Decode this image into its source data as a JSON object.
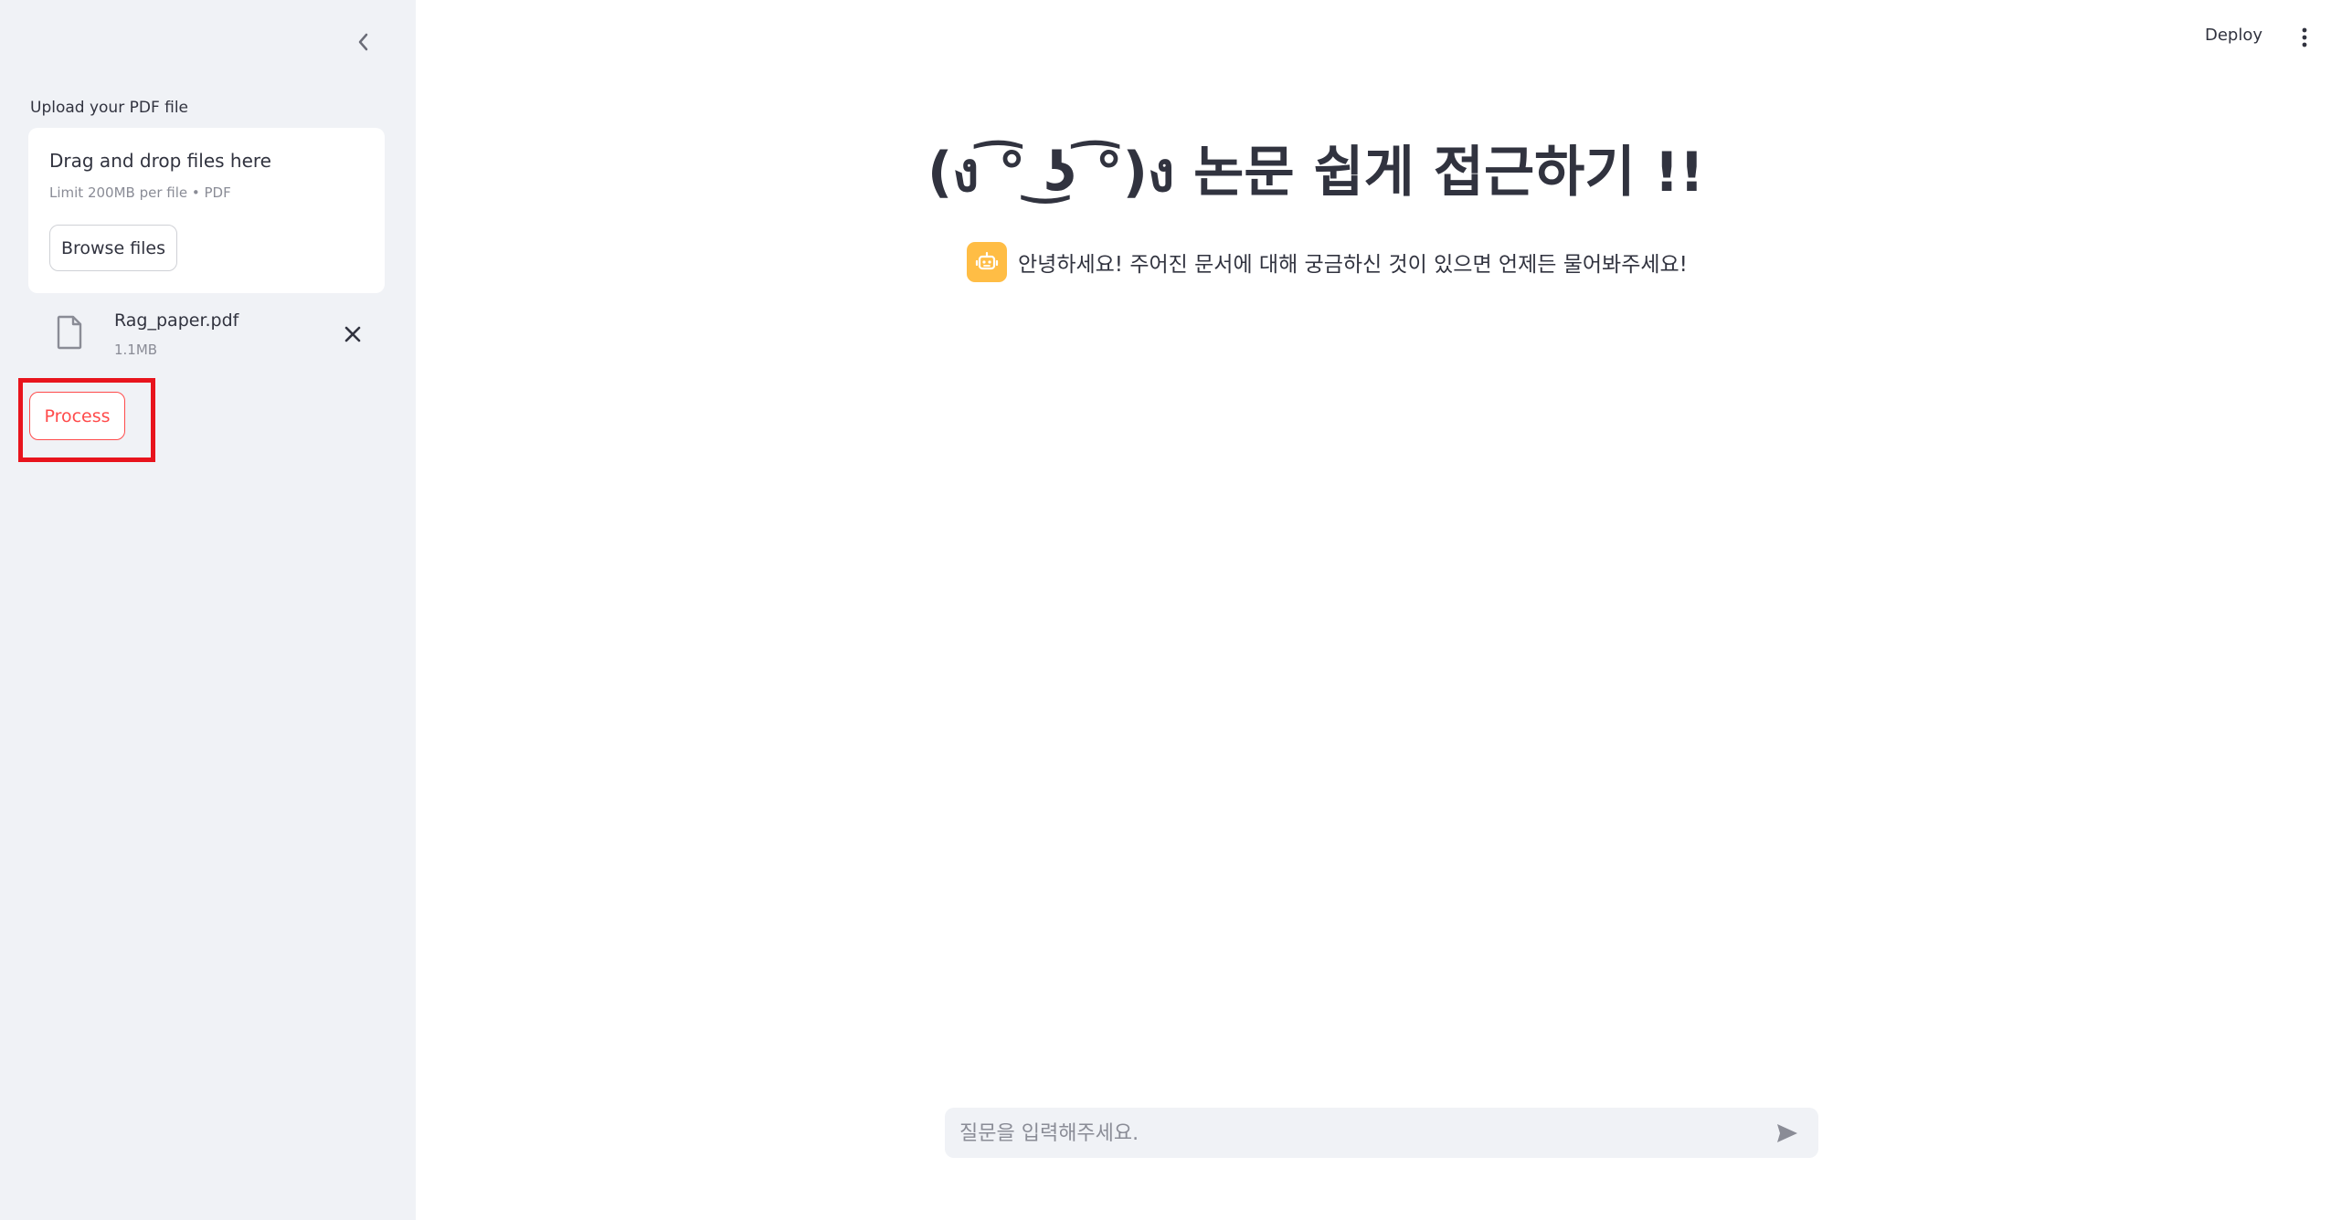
{
  "sidebar": {
    "upload_label": "Upload your PDF file",
    "dropzone": {
      "title": "Drag and drop files here",
      "limit": "Limit 200MB per file • PDF",
      "browse_label": "Browse files"
    },
    "file": {
      "name": "Rag_paper.pdf",
      "size": "1.1MB"
    },
    "process_label": "Process",
    "highlight_color": "#e8141d"
  },
  "header": {
    "deploy_label": "Deploy"
  },
  "main": {
    "title": "(ง ͡° ͜ʖ ͡°)ง 논문 쉽게 접근하기 !!",
    "assistant_message": "안녕하세요! 주어진 문서에 대해 궁금하신 것이 있으면 언제든 물어봐주세요!",
    "chat_input": {
      "placeholder": "질문을 입력해주세요.",
      "value": ""
    }
  },
  "icons": {
    "collapse": "chevron-left-icon",
    "file": "file-icon",
    "remove": "close-icon",
    "menu": "kebab-menu-icon",
    "avatar": "robot-icon",
    "send": "send-icon"
  },
  "colors": {
    "sidebar_bg": "#f0f2f6",
    "accent": "#ff4b4b",
    "avatar_bg": "#ffbd45",
    "text": "#31333f"
  }
}
